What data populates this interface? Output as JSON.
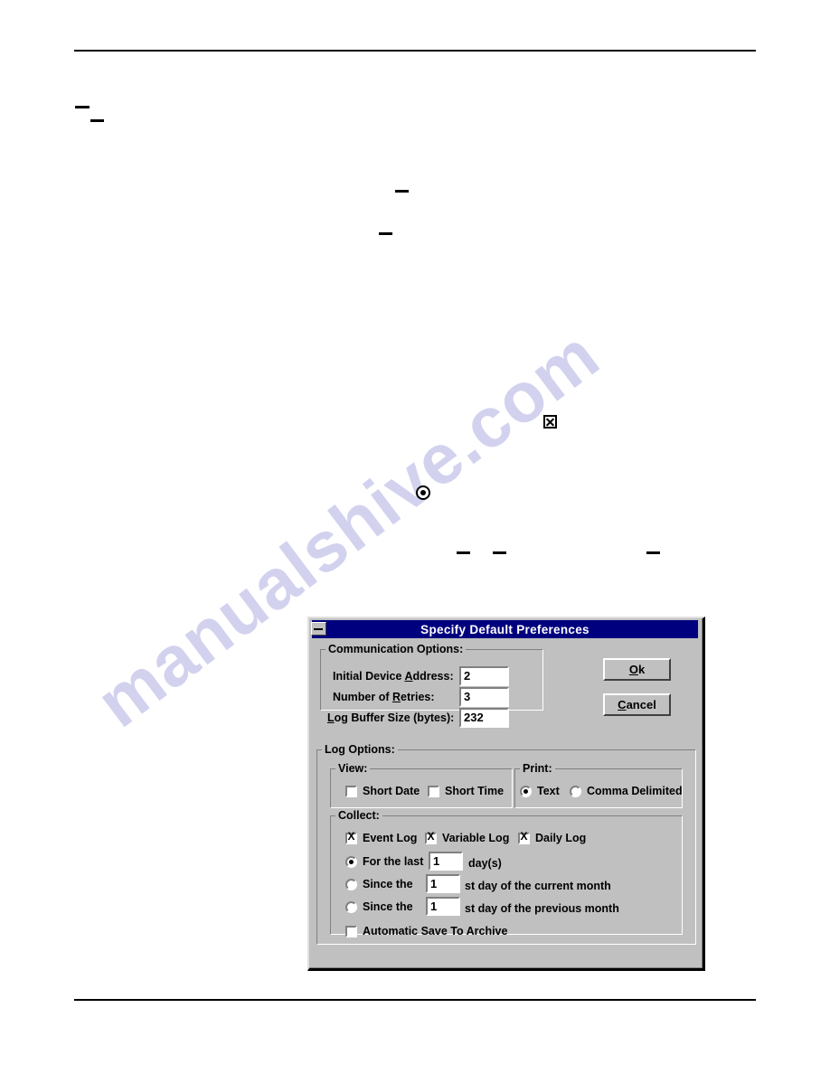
{
  "page": {
    "watermark_text": "manualshive.com",
    "header_rule": true,
    "footer_rule": true,
    "floating_glyphs": [
      "checked-checkbox",
      "selected-radio"
    ]
  },
  "dialog": {
    "title": "Specify Default Preferences",
    "sysmenu_icon": "window-menu-icon",
    "buttons": [
      {
        "name": "ok",
        "label": "Ok",
        "accel": "O"
      },
      {
        "name": "cancel",
        "label": "Cancel",
        "accel": "C"
      }
    ],
    "communication_options": {
      "group_label": "Communication Options:",
      "fields": [
        {
          "name": "initial-device-address",
          "label": "Initial Device Address:",
          "accel": "A",
          "value": "2"
        },
        {
          "name": "number-of-retries",
          "label": "Number of Retries:",
          "accel": "R",
          "value": "3"
        },
        {
          "name": "log-buffer-size",
          "label": "Log Buffer Size (bytes):",
          "accel": "L",
          "value": "232"
        }
      ]
    },
    "log_options": {
      "group_label": "Log Options:",
      "view": {
        "group_label": "View:",
        "checkboxes": [
          {
            "name": "short-date",
            "label": "Short Date",
            "checked": false
          },
          {
            "name": "short-time",
            "label": "Short Time",
            "checked": false
          }
        ]
      },
      "print": {
        "group_label": "Print:",
        "radios": [
          {
            "name": "print-text",
            "label": "Text",
            "selected": true
          },
          {
            "name": "print-comma-delimited",
            "label": "Comma Delimited",
            "selected": false
          }
        ]
      },
      "collect": {
        "group_label": "Collect:",
        "log_checkboxes": [
          {
            "name": "event-log",
            "label": "Event Log",
            "checked": true
          },
          {
            "name": "variable-log",
            "label": "Variable Log",
            "checked": true
          },
          {
            "name": "daily-log",
            "label": "Daily Log",
            "checked": true
          }
        ],
        "range_radios": [
          {
            "name": "for-the-last",
            "label": "For the last",
            "selected": true,
            "value": "1",
            "suffix": "day(s)"
          },
          {
            "name": "since-current-month",
            "label": "Since the",
            "selected": false,
            "value": "1",
            "suffix": "st  day of the current month"
          },
          {
            "name": "since-previous-month",
            "label": "Since the",
            "selected": false,
            "value": "1",
            "suffix": "st  day of the previous month"
          }
        ],
        "auto_save": {
          "name": "automatic-save-to-archive",
          "label": "Automatic Save To Archive",
          "checked": false
        }
      }
    },
    "colors": {
      "titlebar": "#00007f",
      "titlebar_text": "#ffffff",
      "face": "#c0c0c0",
      "shadow": "#808080",
      "highlight": "#ffffff",
      "dark": "#000000",
      "field_bg": "#ffffff",
      "watermark": "#d2d2ef"
    }
  }
}
